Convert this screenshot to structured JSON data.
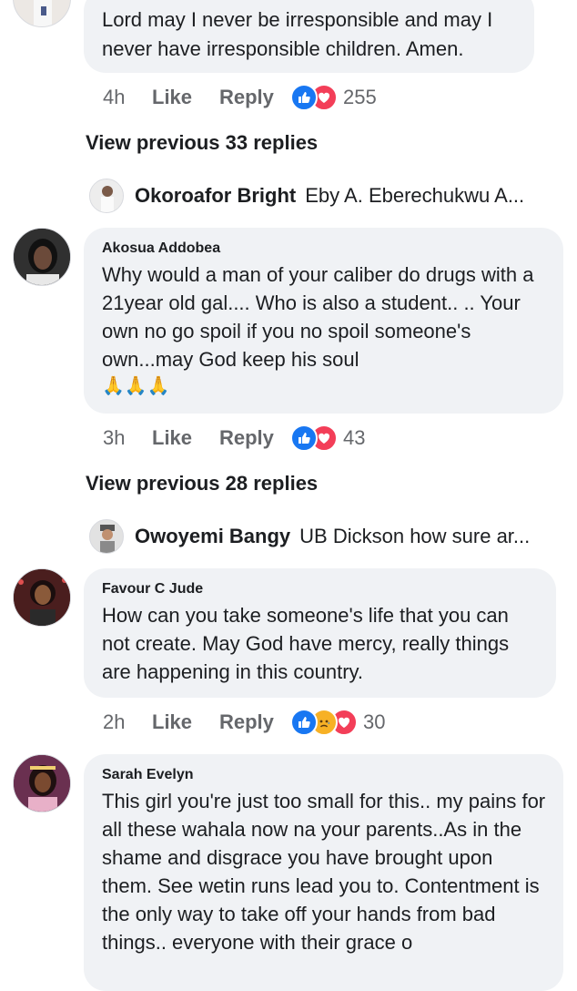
{
  "comments": [
    {
      "text": "Lord may I never be irresponsible and may I never have irresponsible children. Amen.",
      "time": "4h",
      "like_label": "Like",
      "reply_label": "Reply",
      "reaction_count": "255",
      "reactions": [
        "like-icon",
        "love-icon"
      ],
      "view_previous": "View previous 33 replies",
      "reply_preview": {
        "name": "Okoroafor Bright",
        "text": "Eby A. Eberechukwu A..."
      }
    },
    {
      "author": "Akosua Addobea",
      "text": "Why would a man of your caliber do drugs with a 21year old gal.... Who is also a student.. .. Your own no go spoil if you no spoil someone's own...may God keep his soul",
      "emoji": "🙏🙏🙏",
      "time": "3h",
      "like_label": "Like",
      "reply_label": "Reply",
      "reaction_count": "43",
      "reactions": [
        "like-icon",
        "love-icon"
      ],
      "view_previous": "View previous 28 replies",
      "reply_preview": {
        "name": "Owoyemi Bangy",
        "text": "UB Dickson how sure ar..."
      }
    },
    {
      "author": "Favour C Jude",
      "text": "How can you take someone's life that you can not create. May God have mercy, really things are happening in this country.",
      "time": "2h",
      "like_label": "Like",
      "reply_label": "Reply",
      "reaction_count": "30",
      "reactions": [
        "like-icon",
        "sad-icon",
        "love-icon"
      ]
    },
    {
      "author": "Sarah Evelyn",
      "text": "This girl you're just too small for this.. my pains for all these wahala now na your parents..As in the shame and disgrace you have brought upon them. See wetin runs lead you to. Contentment is the only way to take off your hands from bad things.. everyone with their grace o"
    }
  ],
  "colors": {
    "bubble": "#f0f2f5",
    "meta": "#65676b",
    "like": "#1877f2",
    "love": "#f33e58",
    "sad": "#f7b125"
  }
}
